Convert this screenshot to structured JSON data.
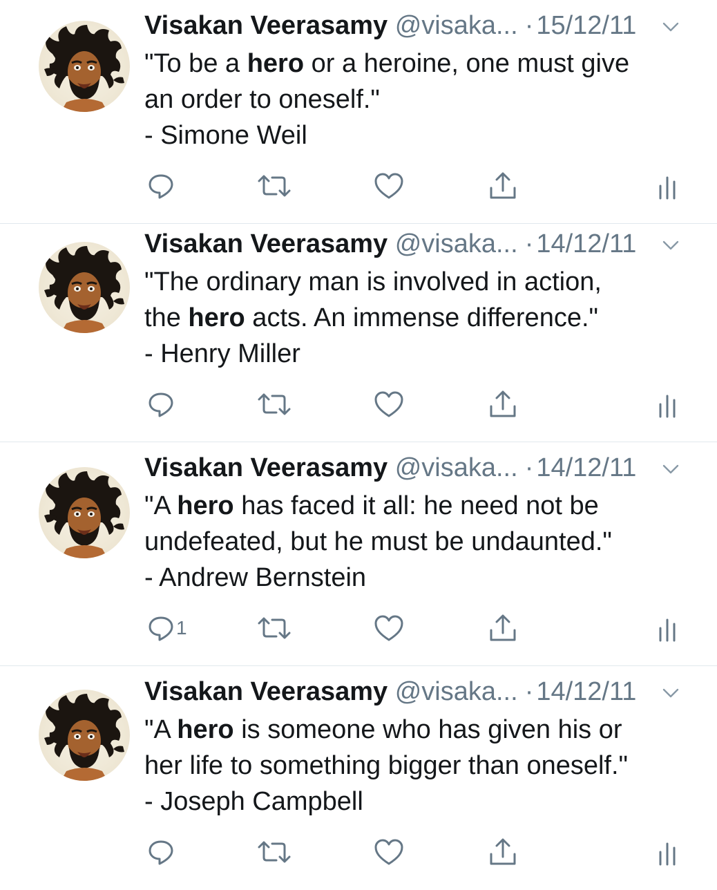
{
  "tweets": [
    {
      "name": "Visakan Veerasamy",
      "handle": "@visaka...",
      "dot": "·",
      "date": "15/12/11",
      "body": [
        {
          "t": "\"To be a ",
          "b": false
        },
        {
          "t": "hero",
          "b": true
        },
        {
          "t": " or a heroine, one must give",
          "b": false
        },
        {
          "br": true
        },
        {
          "t": "an order to oneself.\"",
          "b": false
        },
        {
          "br": true
        },
        {
          "t": "- Simone Weil",
          "b": false
        }
      ],
      "reply_count": ""
    },
    {
      "name": "Visakan Veerasamy",
      "handle": "@visaka...",
      "dot": "·",
      "date": "14/12/11",
      "body": [
        {
          "t": "\"The ordinary man is involved in action,",
          "b": false
        },
        {
          "br": true
        },
        {
          "t": "the ",
          "b": false
        },
        {
          "t": "hero",
          "b": true
        },
        {
          "t": " acts. An immense difference.\"",
          "b": false
        },
        {
          "br": true
        },
        {
          "t": "- Henry Miller",
          "b": false
        }
      ],
      "reply_count": ""
    },
    {
      "name": "Visakan Veerasamy",
      "handle": "@visaka...",
      "dot": "·",
      "date": "14/12/11",
      "body": [
        {
          "t": "\"A ",
          "b": false
        },
        {
          "t": "hero",
          "b": true
        },
        {
          "t": " has faced it all: he need not be",
          "b": false
        },
        {
          "br": true
        },
        {
          "t": "undefeated, but he must be undaunted.\"",
          "b": false
        },
        {
          "br": true
        },
        {
          "t": "- Andrew Bernstein",
          "b": false
        }
      ],
      "reply_count": "1"
    },
    {
      "name": "Visakan Veerasamy",
      "handle": "@visaka...",
      "dot": "·",
      "date": "14/12/11",
      "body": [
        {
          "t": "\"A ",
          "b": false
        },
        {
          "t": "hero",
          "b": true
        },
        {
          "t": " is someone who has given his or",
          "b": false
        },
        {
          "br": true
        },
        {
          "t": "her life to something bigger than oneself.\"",
          "b": false
        },
        {
          "br": true
        },
        {
          "t": "- Joseph Campbell",
          "b": false
        }
      ],
      "reply_count": ""
    }
  ],
  "icons": {
    "reply": "reply-icon",
    "retweet": "retweet-icon",
    "like": "heart-icon",
    "share": "share-icon",
    "analytics": "analytics-icon",
    "caret": "chevron-down-icon"
  },
  "colors": {
    "text": "#14171a",
    "secondary": "#657786",
    "divider": "#e1e8ed"
  }
}
